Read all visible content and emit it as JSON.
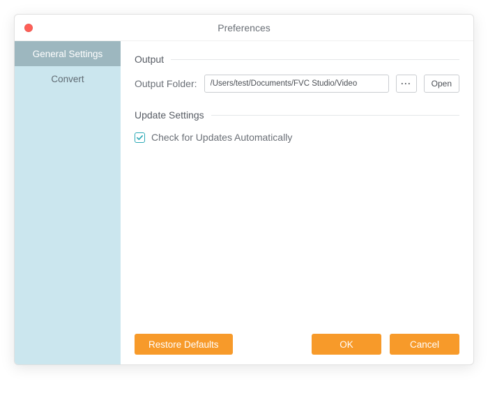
{
  "window": {
    "title": "Preferences"
  },
  "sidebar": {
    "items": [
      {
        "label": "General Settings",
        "active": true
      },
      {
        "label": "Convert",
        "active": false
      }
    ]
  },
  "sections": {
    "output": {
      "title": "Output",
      "folder_label": "Output Folder:",
      "folder_path": "/Users/test/Documents/FVC Studio/Video",
      "browse_label": "···",
      "open_label": "Open"
    },
    "updates": {
      "title": "Update Settings",
      "checkbox_label": "Check for Updates Automatically",
      "checked": true
    }
  },
  "footer": {
    "restore_label": "Restore Defaults",
    "ok_label": "OK",
    "cancel_label": "Cancel"
  },
  "colors": {
    "accent": "#f79a2a",
    "sidebar_bg": "#cbe6ee",
    "sidebar_active": "#9db7bf",
    "check": "#29a8b5"
  }
}
